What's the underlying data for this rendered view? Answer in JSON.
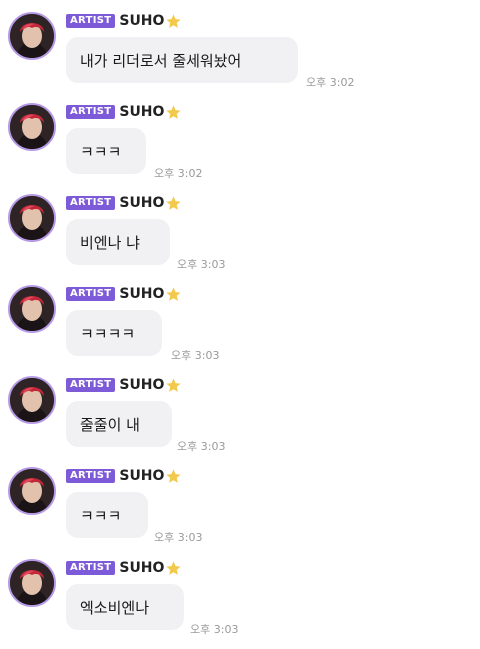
{
  "messages": [
    {
      "badge": "ARTIST",
      "sender": "SUHO",
      "text": "내가 리더로서 줄세워놨어",
      "time": "오후 3:02"
    },
    {
      "badge": "ARTIST",
      "sender": "SUHO",
      "text": "ㅋㅋㅋ",
      "time": "오후 3:02"
    },
    {
      "badge": "ARTIST",
      "sender": "SUHO",
      "text": "비엔나 냐",
      "time": "오후 3:03"
    },
    {
      "badge": "ARTIST",
      "sender": "SUHO",
      "text": "ㅋㅋㅋㅋ",
      "time": "오후 3:03"
    },
    {
      "badge": "ARTIST",
      "sender": "SUHO",
      "text": "줄줄이 내",
      "time": "오후 3:03"
    },
    {
      "badge": "ARTIST",
      "sender": "SUHO",
      "text": "ㅋㅋㅋ",
      "time": "오후 3:03"
    },
    {
      "badge": "ARTIST",
      "sender": "SUHO",
      "text": "엑소비엔나",
      "time": "오후 3:03"
    }
  ],
  "icons": {
    "avatar": "profile-photo",
    "star": "star-icon"
  },
  "colors": {
    "badge": "#7d5ad8",
    "avatar_ring": "#b79ae6",
    "bubble": "#f1f1f3",
    "star": "#f2c94c"
  }
}
